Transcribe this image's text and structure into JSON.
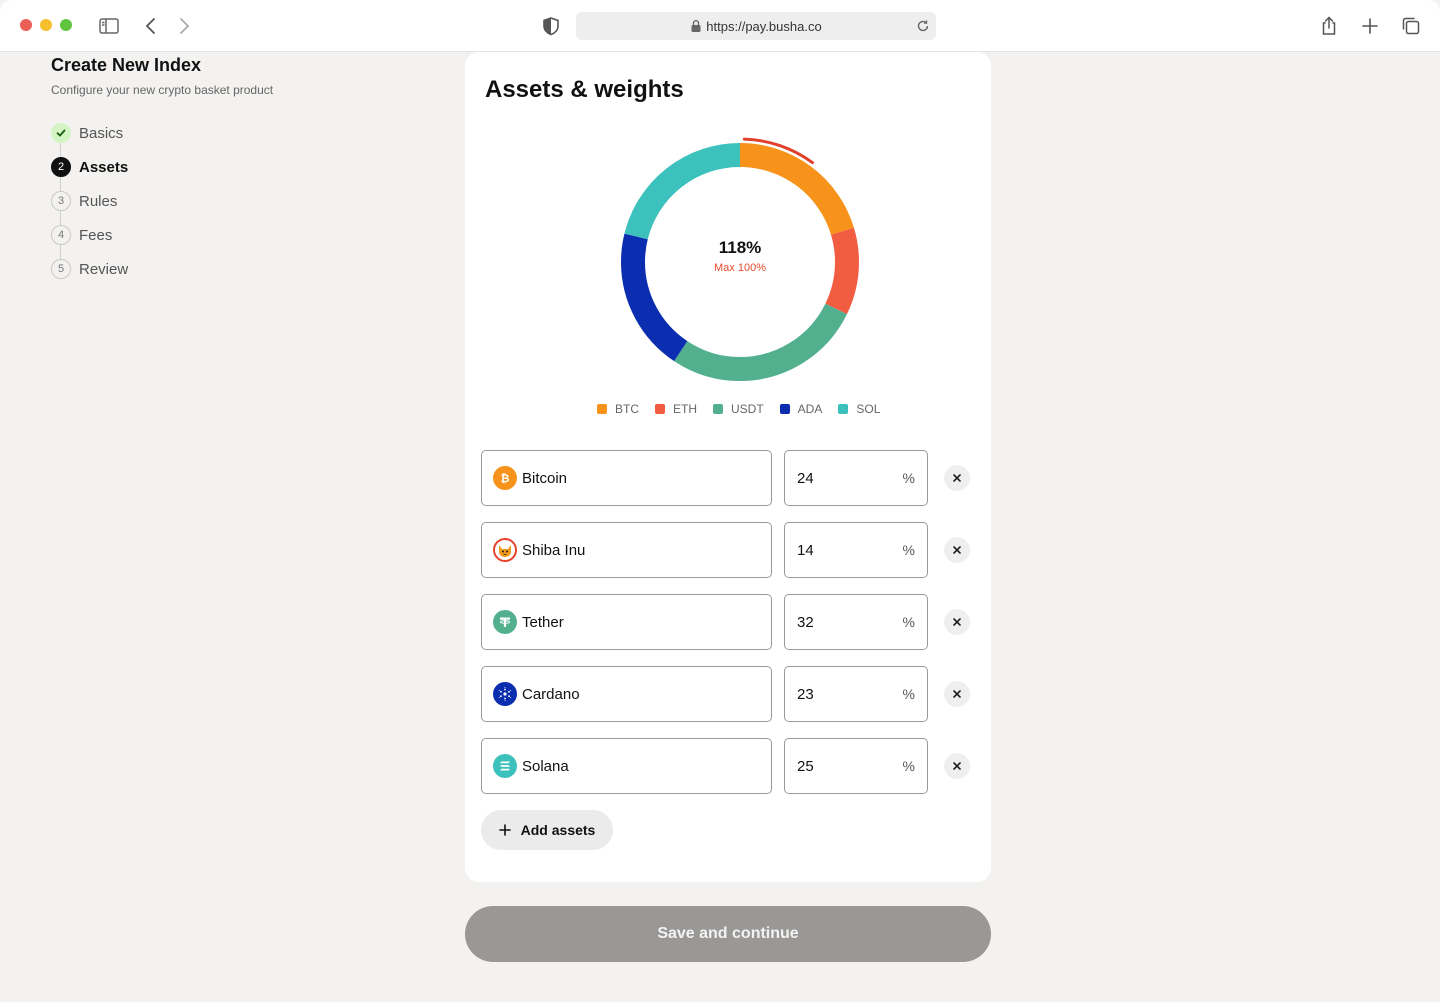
{
  "browser": {
    "url": "https://pay.busha.co"
  },
  "sidebar": {
    "title": "Create New Index",
    "subtitle": "Configure your new crypto basket product",
    "steps": [
      {
        "num": "",
        "label": "Basics",
        "state": "done"
      },
      {
        "num": "2",
        "label": "Assets",
        "state": "active"
      },
      {
        "num": "3",
        "label": "Rules",
        "state": "pending"
      },
      {
        "num": "4",
        "label": "Fees",
        "state": "pending"
      },
      {
        "num": "5",
        "label": "Review",
        "state": "pending"
      }
    ]
  },
  "card": {
    "title": "Assets & weights",
    "total_label": "118%",
    "max_label": "Max 100%",
    "add_label": "Add assets"
  },
  "chart_data": {
    "type": "pie",
    "style": "donut",
    "categories": [
      "BTC",
      "ETH",
      "USDT",
      "ADA",
      "SOL"
    ],
    "values": [
      24,
      14,
      32,
      23,
      25
    ],
    "colors": [
      "#f7931a",
      "#f25c40",
      "#52b08f",
      "#0a2eaf",
      "#3dc1bd"
    ],
    "total": 118,
    "max": 100,
    "overflow_color": "#e0402c",
    "legend": "bottom"
  },
  "assets": [
    {
      "name": "Bitcoin",
      "weight": "24",
      "unit": "%",
      "icon": "bitcoin-icon",
      "color": "#f7931a"
    },
    {
      "name": "Shiba Inu",
      "weight": "14",
      "unit": "%",
      "icon": "shiba-inu-icon",
      "color": "#f25c40"
    },
    {
      "name": "Tether",
      "weight": "32",
      "unit": "%",
      "icon": "tether-icon",
      "color": "#52b08f"
    },
    {
      "name": "Cardano",
      "weight": "23",
      "unit": "%",
      "icon": "cardano-icon",
      "color": "#0a2eaf"
    },
    {
      "name": "Solana",
      "weight": "25",
      "unit": "%",
      "icon": "solana-icon",
      "color": "#3dc1bd"
    }
  ],
  "footer": {
    "save_label": "Save and continue"
  }
}
